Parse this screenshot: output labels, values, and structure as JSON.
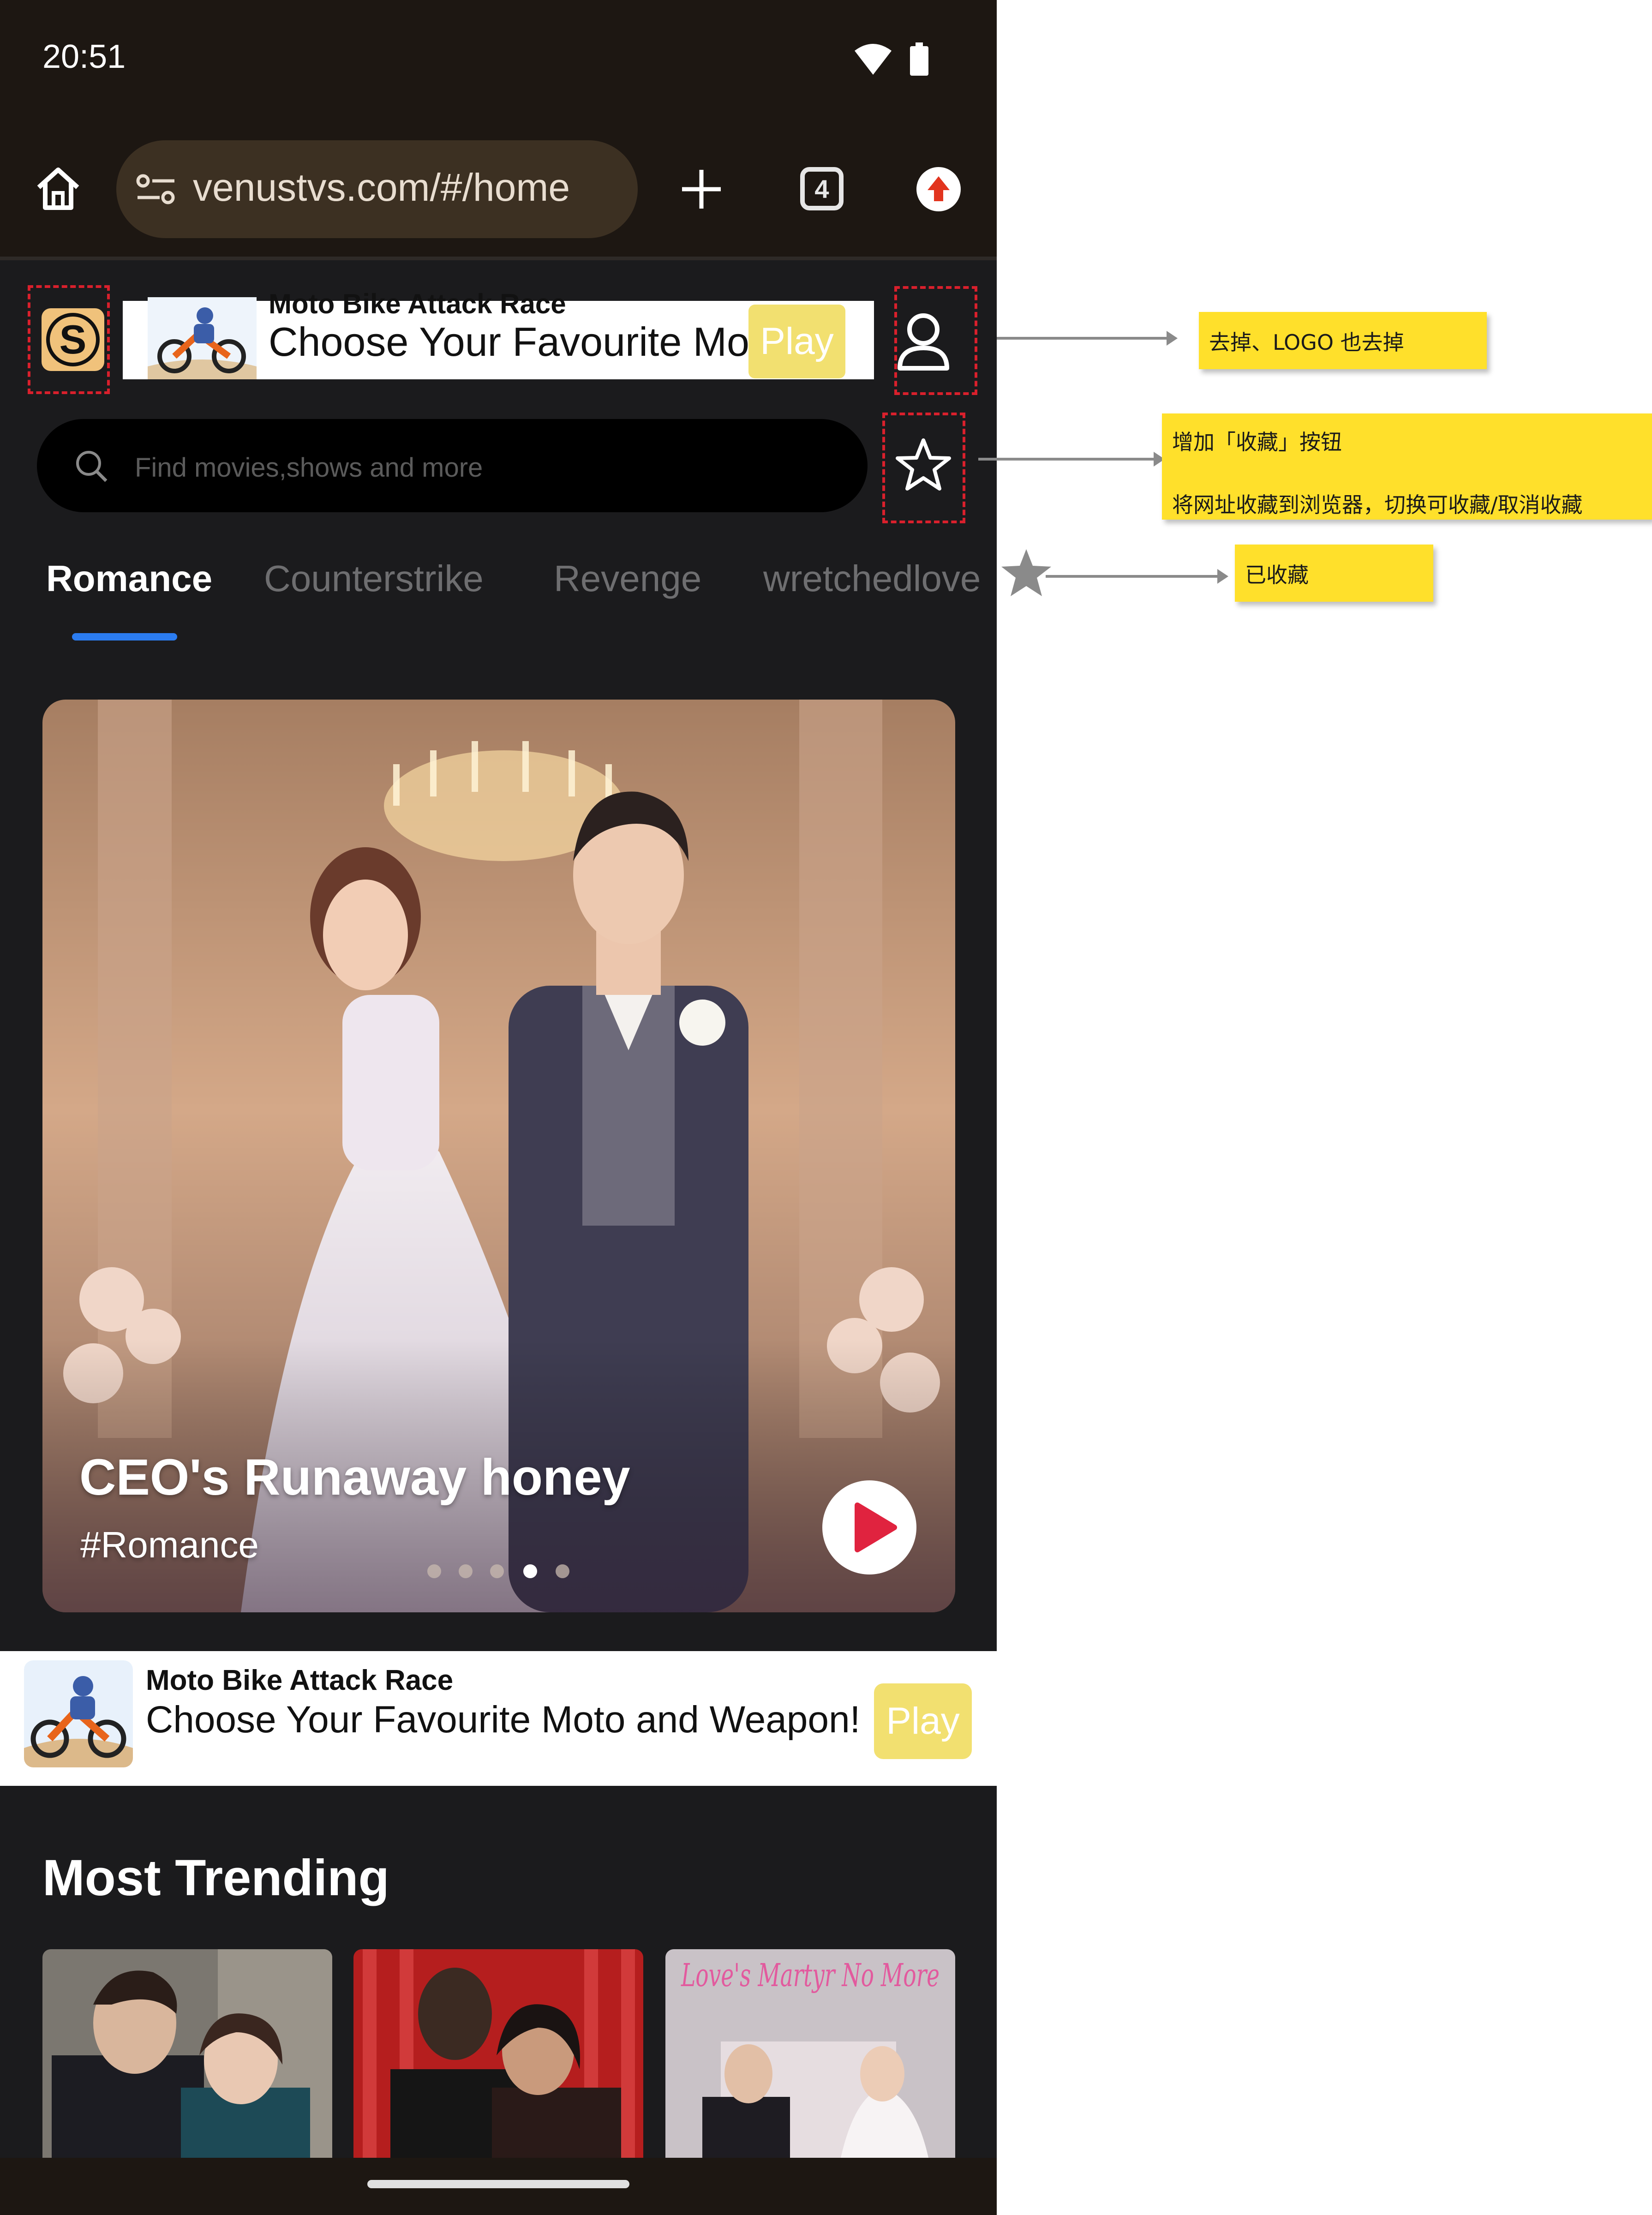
{
  "status_bar": {
    "time": "20:51"
  },
  "browser": {
    "url": "venustvs.com/#/home",
    "tab_count": "4"
  },
  "header": {
    "logo_letter": "S"
  },
  "top_ad": {
    "title": "Moto Bike Attack Race",
    "text": "Choose Your Favourite Mo...",
    "play_label": "Play"
  },
  "search": {
    "placeholder": "Find movies,shows and more"
  },
  "tabs": [
    {
      "label": "Romance",
      "active": true
    },
    {
      "label": "Counterstrike",
      "active": false
    },
    {
      "label": "Revenge",
      "active": false
    },
    {
      "label": "wretchedlove",
      "active": false
    }
  ],
  "banner": {
    "title": "CEO's Runaway honey",
    "genre": "#Romance",
    "slides_total": 5,
    "active_slide": 4
  },
  "inline_ad": {
    "title": "Moto Bike Attack Race",
    "text": "Choose Your Favourite Moto and Weapon!",
    "play_label": "Play"
  },
  "trending": {
    "title": "Most Trending",
    "posters": [
      {
        "name": "poster-1"
      },
      {
        "name": "poster-2"
      },
      {
        "name": "poster-3",
        "overlay_text": "Love's Martyr No More"
      }
    ]
  },
  "annotations": {
    "remove_note": "去掉、LOGO 也去掉",
    "add_note_line1": "增加「收藏」按钮",
    "add_note_line2": "将网址收藏到浏览器，切换可收藏/取消收藏",
    "starred_note": "已收藏"
  },
  "colors": {
    "browser_bg": "#1d1712",
    "app_bg": "#1b1b1d",
    "tab_accent": "#2b7cf0",
    "play_button": "#f2e070",
    "play_icon": "#e0233f",
    "note_bg": "#ffe02b",
    "highlight_dash": "#d9202c"
  }
}
